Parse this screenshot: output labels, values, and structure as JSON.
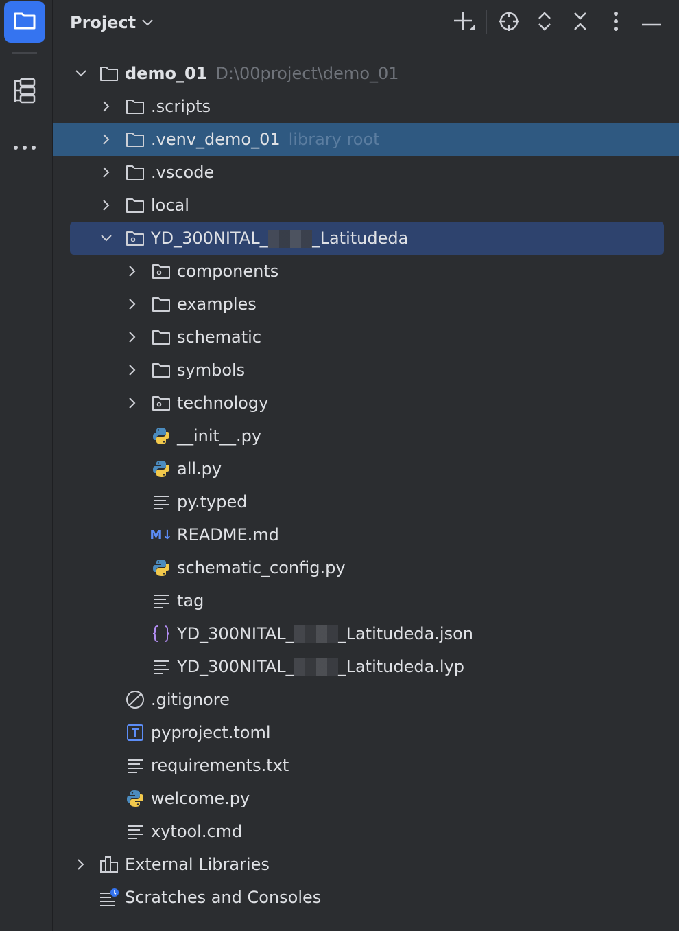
{
  "header": {
    "title": "Project"
  },
  "tree": {
    "root": {
      "name": "demo_01",
      "path": "D:\\00project\\demo_01"
    },
    "items": [
      {
        "label": ".scripts"
      },
      {
        "label": ".venv_demo_01",
        "hint": "library root"
      },
      {
        "label": ".vscode"
      },
      {
        "label": "local"
      },
      {
        "label_prefix": "YD_300NITAL_",
        "label_suffix": "_Latitudeda"
      },
      {
        "label": "components"
      },
      {
        "label": "examples"
      },
      {
        "label": "schematic"
      },
      {
        "label": "symbols"
      },
      {
        "label": "technology"
      },
      {
        "label": "__init__.py"
      },
      {
        "label": "all.py"
      },
      {
        "label": "py.typed"
      },
      {
        "label": "README.md"
      },
      {
        "label": "schematic_config.py"
      },
      {
        "label": "tag"
      },
      {
        "label_prefix": "YD_300NITAL_",
        "label_suffix": "_Latitudeda.json"
      },
      {
        "label_prefix": "YD_300NITAL_",
        "label_suffix": "_Latitudeda.lyp"
      },
      {
        "label": ".gitignore"
      },
      {
        "label": "pyproject.toml"
      },
      {
        "label": "requirements.txt"
      },
      {
        "label": "welcome.py"
      },
      {
        "label": "xytool.cmd"
      },
      {
        "label": "External Libraries"
      },
      {
        "label": "Scratches and Consoles"
      }
    ]
  },
  "icons": {
    "markdown_text": "M↓"
  },
  "colors": {
    "background": "#2b2d30",
    "active_tool": "#3574f0",
    "selection": "#2e436e",
    "highlight_row": "#2f5981",
    "python_blue": "#4b8bbe",
    "python_yellow": "#f2c94c",
    "json_brace": "#b18cf0",
    "markdown": "#5c8df6",
    "toml": "#5c8df6"
  }
}
